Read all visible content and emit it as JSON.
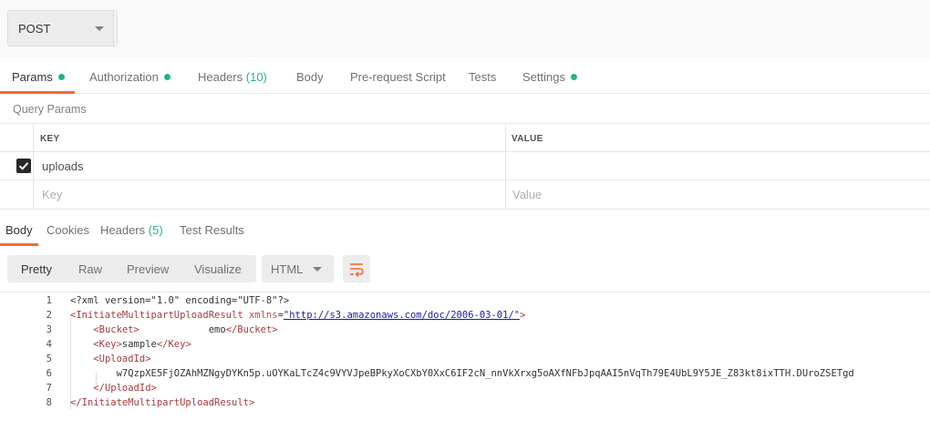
{
  "request": {
    "method": "POST"
  },
  "request_tabs": [
    {
      "label": "Params",
      "dot": true
    },
    {
      "label": "Authorization",
      "dot": true
    },
    {
      "label": "Headers",
      "count": "(10)"
    },
    {
      "label": "Body"
    },
    {
      "label": "Pre-request Script"
    },
    {
      "label": "Tests"
    },
    {
      "label": "Settings",
      "dot": true
    }
  ],
  "query_params": {
    "title": "Query Params",
    "key_header": "KEY",
    "value_header": "VALUE",
    "rows": [
      {
        "key": "uploads",
        "value": "",
        "checked": true
      }
    ],
    "key_placeholder": "Key",
    "value_placeholder": "Value"
  },
  "response_tabs": [
    {
      "label": "Body"
    },
    {
      "label": "Cookies"
    },
    {
      "label": "Headers",
      "count": "(5)"
    },
    {
      "label": "Test Results"
    }
  ],
  "response_toolbar": {
    "views": [
      "Pretty",
      "Raw",
      "Preview",
      "Visualize"
    ],
    "format": "HTML",
    "wrap_icon": "wrap-lines-icon"
  },
  "code": {
    "lines": [
      {
        "n": "1",
        "parts": [
          [
            "plain",
            "<?xml version=\"1.0\" encoding=\"UTF-8\"?>"
          ]
        ]
      },
      {
        "n": "2",
        "parts": [
          [
            "tag",
            "<InitiateMultipartUploadResult "
          ],
          [
            "attr",
            "xmlns"
          ],
          [
            "plain",
            "="
          ],
          [
            "aval",
            "\"http://s3.amazonaws.com/doc/2006-03-01/\""
          ],
          [
            "tag",
            ">"
          ]
        ]
      },
      {
        "n": "3",
        "parts": [
          [
            "plain",
            "    "
          ],
          [
            "tag",
            "<Bucket>"
          ],
          [
            "plain",
            "            emo"
          ],
          [
            "tag",
            "</Bucket>"
          ]
        ]
      },
      {
        "n": "4",
        "parts": [
          [
            "plain",
            "    "
          ],
          [
            "tag",
            "<Key>"
          ],
          [
            "plain",
            "sample"
          ],
          [
            "tag",
            "</Key>"
          ]
        ]
      },
      {
        "n": "5",
        "parts": [
          [
            "plain",
            "    "
          ],
          [
            "tag",
            "<UploadId>"
          ]
        ]
      },
      {
        "n": "6",
        "parts": [
          [
            "plain",
            "        w7QzpXE5FjOZAhMZNgyDYKn5p.uOYKaLTcZ4c9VYVJpeBPkyXoCXbY0XxC6IF2cN_nnVkXrxg5oAXfNFbJpqAAI5nVqTh79E4UbL9Y5JE_Z83kt8ixTTH.DUroZSETgd"
          ]
        ]
      },
      {
        "n": "7",
        "parts": [
          [
            "plain",
            "    "
          ],
          [
            "tag",
            "</UploadId>"
          ]
        ]
      },
      {
        "n": "8",
        "parts": [
          [
            "tag",
            "</InitiateMultipartUploadResult>"
          ]
        ]
      }
    ]
  },
  "colors": {
    "accent": "#f26b3a",
    "status_green": "#26b47f"
  }
}
